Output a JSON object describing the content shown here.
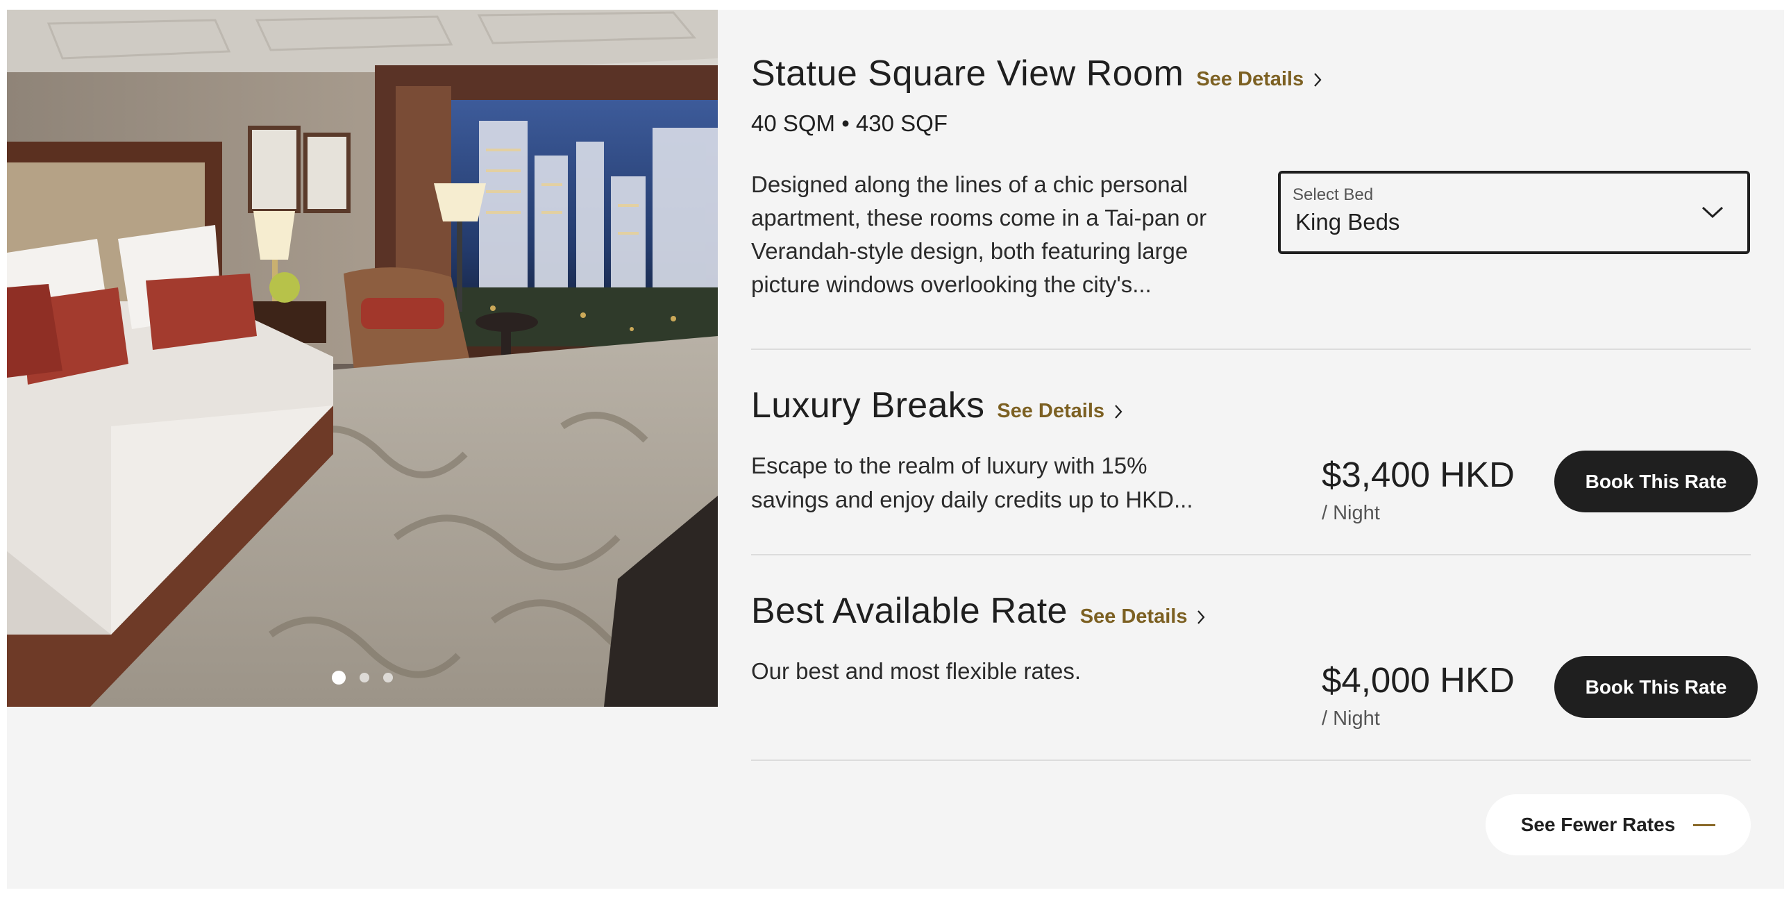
{
  "room": {
    "title": "Statue Square View Room",
    "see_details": "See Details",
    "size": "40 SQM • 430 SQF",
    "description": "Designed along the lines of a chic personal apartment, these rooms come in a Tai-pan or Verandah-style design, both featuring large picture windows overlooking the city's...",
    "gallery": {
      "slide_count": 3,
      "active_slide": 1
    }
  },
  "bed_select": {
    "label": "Select Bed",
    "value": "King Beds"
  },
  "rates": [
    {
      "title": "Luxury Breaks",
      "see_details": "See Details",
      "description": "Escape to the realm of luxury with 15% savings and enjoy daily credits up to HKD...",
      "price": "$3,400 HKD",
      "per": "/ Night",
      "button": "Book This Rate"
    },
    {
      "title": "Best Available Rate",
      "see_details": "See Details",
      "description": "Our best and most flexible rates.",
      "price": "$4,000 HKD",
      "per": "/ Night",
      "button": "Book This Rate"
    }
  ],
  "see_fewer": {
    "label": "See Fewer Rates"
  },
  "colors": {
    "accent_gold": "#7c6022",
    "button_dark": "#1f1f1f",
    "panel_bg": "#f4f4f4"
  }
}
